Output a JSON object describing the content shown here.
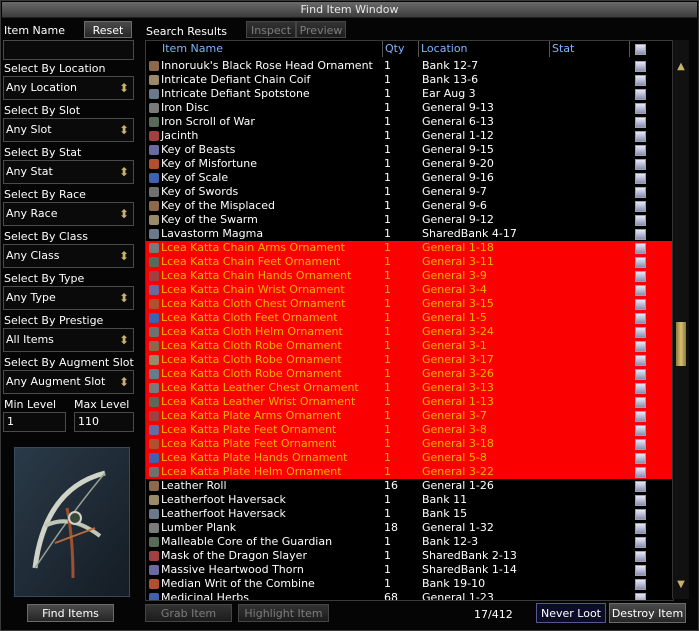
{
  "window": {
    "title": "Find Item Window"
  },
  "left": {
    "item_name_label": "Item Name",
    "reset_label": "Reset",
    "item_name_value": "",
    "filters": [
      {
        "label": "Select By Location",
        "value": "Any Location"
      },
      {
        "label": "Select By Slot",
        "value": "Any Slot"
      },
      {
        "label": "Select By Stat",
        "value": "Any Stat"
      },
      {
        "label": "Select By Race",
        "value": "Any Race"
      },
      {
        "label": "Select By Class",
        "value": "Any Class"
      },
      {
        "label": "Select By Type",
        "value": "Any Type"
      },
      {
        "label": "Select By Prestige",
        "value": "All Items"
      },
      {
        "label": "Select By Augment Slot",
        "value": "Any Augment Slot"
      }
    ],
    "min_level_label": "Min Level",
    "max_level_label": "Max Level",
    "min_level_value": "1",
    "max_level_value": "110",
    "find_items_label": "Find Items"
  },
  "results": {
    "title": "Search Results",
    "inspect_label": "Inspect",
    "preview_label": "Preview",
    "columns": {
      "name": "Item Name",
      "qty": "Qty",
      "location": "Location",
      "stat": "Stat"
    },
    "rows": [
      {
        "name": "Innoruuk's Black Rose Head Ornament",
        "qty": "1",
        "location": "Bank 12-7",
        "selected": false
      },
      {
        "name": "Intricate Defiant Chain Coif",
        "qty": "1",
        "location": "Bank 13-6",
        "selected": false
      },
      {
        "name": "Intricate Defiant Spotstone",
        "qty": "1",
        "location": "Ear Aug 3",
        "selected": false
      },
      {
        "name": "Iron Disc",
        "qty": "1",
        "location": "General 9-13",
        "selected": false
      },
      {
        "name": "Iron Scroll of War",
        "qty": "1",
        "location": "General 6-13",
        "selected": false
      },
      {
        "name": "Jacinth",
        "qty": "1",
        "location": "General 1-12",
        "selected": false
      },
      {
        "name": "Key of Beasts",
        "qty": "1",
        "location": "General 9-15",
        "selected": false
      },
      {
        "name": "Key of Misfortune",
        "qty": "1",
        "location": "General 9-20",
        "selected": false
      },
      {
        "name": "Key of Scale",
        "qty": "1",
        "location": "General 9-16",
        "selected": false
      },
      {
        "name": "Key of Swords",
        "qty": "1",
        "location": "General 9-7",
        "selected": false
      },
      {
        "name": "Key of the Misplaced",
        "qty": "1",
        "location": "General 9-6",
        "selected": false
      },
      {
        "name": "Key of the Swarm",
        "qty": "1",
        "location": "General 9-12",
        "selected": false
      },
      {
        "name": "Lavastorm Magma",
        "qty": "1",
        "location": "SharedBank 4-17",
        "selected": false
      },
      {
        "name": "Lcea Katta Chain Arms Ornament",
        "qty": "1",
        "location": "General 1-18",
        "selected": true
      },
      {
        "name": "Lcea Katta Chain Feet Ornament",
        "qty": "1",
        "location": "General 3-11",
        "selected": true
      },
      {
        "name": "Lcea Katta Chain Hands Ornament",
        "qty": "1",
        "location": "General 3-9",
        "selected": true
      },
      {
        "name": "Lcea Katta Chain Wrist Ornament",
        "qty": "1",
        "location": "General 3-4",
        "selected": true
      },
      {
        "name": "Lcea Katta Cloth Chest Ornament",
        "qty": "1",
        "location": "General 3-15",
        "selected": true
      },
      {
        "name": "Lcea Katta Cloth Feet Ornament",
        "qty": "1",
        "location": "General 1-5",
        "selected": true
      },
      {
        "name": "Lcea Katta Cloth Helm Ornament",
        "qty": "1",
        "location": "General 3-24",
        "selected": true
      },
      {
        "name": "Lcea Katta Cloth Robe Ornament",
        "qty": "1",
        "location": "General 3-1",
        "selected": true
      },
      {
        "name": "Lcea Katta Cloth Robe Ornament",
        "qty": "1",
        "location": "General 3-17",
        "selected": true
      },
      {
        "name": "Lcea Katta Cloth Robe Ornament",
        "qty": "1",
        "location": "General 3-26",
        "selected": true
      },
      {
        "name": "Lcea Katta Leather Chest Ornament",
        "qty": "1",
        "location": "General 3-13",
        "selected": true
      },
      {
        "name": "Lcea Katta Leather Wrist Ornament",
        "qty": "1",
        "location": "General 1-13",
        "selected": true
      },
      {
        "name": "Lcea Katta Plate Arms Ornament",
        "qty": "1",
        "location": "General 3-7",
        "selected": true
      },
      {
        "name": "Lcea Katta Plate Feet Ornament",
        "qty": "1",
        "location": "General 3-8",
        "selected": true
      },
      {
        "name": "Lcea Katta Plate Feet Ornament",
        "qty": "1",
        "location": "General 3-18",
        "selected": true
      },
      {
        "name": "Lcea Katta Plate Hands Ornament",
        "qty": "1",
        "location": "General 5-8",
        "selected": true
      },
      {
        "name": "Lcea Katta Plate Helm Ornament",
        "qty": "1",
        "location": "General 3-22",
        "selected": true
      },
      {
        "name": "Leather Roll",
        "qty": "16",
        "location": "General 1-26",
        "selected": false
      },
      {
        "name": "Leatherfoot Haversack",
        "qty": "1",
        "location": "Bank 11",
        "selected": false
      },
      {
        "name": "Leatherfoot Haversack",
        "qty": "1",
        "location": "Bank 15",
        "selected": false
      },
      {
        "name": "Lumber Plank",
        "qty": "18",
        "location": "General 1-32",
        "selected": false
      },
      {
        "name": "Malleable Core of the Guardian",
        "qty": "1",
        "location": "Bank 12-3",
        "selected": false
      },
      {
        "name": "Mask of the Dragon Slayer",
        "qty": "1",
        "location": "SharedBank 2-13",
        "selected": false
      },
      {
        "name": "Massive Heartwood Thorn",
        "qty": "1",
        "location": "SharedBank 1-14",
        "selected": false
      },
      {
        "name": "Median Writ of the Combine",
        "qty": "1",
        "location": "Bank 19-10",
        "selected": false
      },
      {
        "name": "Medicinal Herbs",
        "qty": "68",
        "location": "General 1-23",
        "selected": false
      }
    ]
  },
  "footer": {
    "grab_item_label": "Grab Item",
    "highlight_item_label": "Highlight Item",
    "count_text": "17/412",
    "never_loot_label": "Never Loot",
    "destroy_item_label": "Destroy Item"
  }
}
